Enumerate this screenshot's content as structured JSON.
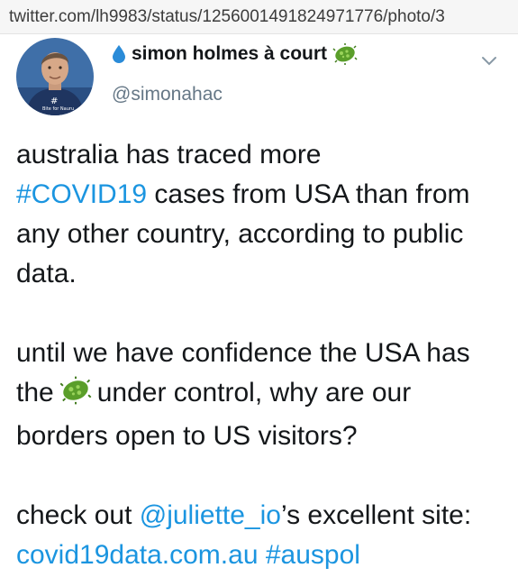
{
  "browser": {
    "url": "twitter.com/lh9983/status/1256001491824971776/photo/3"
  },
  "tweet": {
    "author_name": "simon holmes à court",
    "handle": "@simonahac",
    "avatar_caption": "Bite for Nauru",
    "line1_a": "australia has traced more",
    "hashtag_covid": "#COVID19",
    "line1_b": " cases from USA than from any other country, according to public data.",
    "line2_a": "until we have confidence the USA has the",
    "line2_b": "under control, why are our borders open to US visitors?",
    "line3_a": "check out ",
    "mention": "@juliette_io",
    "line3_b": "’s excellent site: ",
    "site_link": "covid19data.com.au",
    "space": " ",
    "hashtag_auspol": "#auspol"
  },
  "icons": {
    "drop": "water-drop-icon",
    "virus": "microbe-icon",
    "menu": "chevron-down-icon"
  },
  "colors": {
    "link": "#1b95e0",
    "handle": "#657786",
    "text": "#14171a",
    "virus": "#5a9e2a",
    "drop": "#2a8bd8"
  }
}
